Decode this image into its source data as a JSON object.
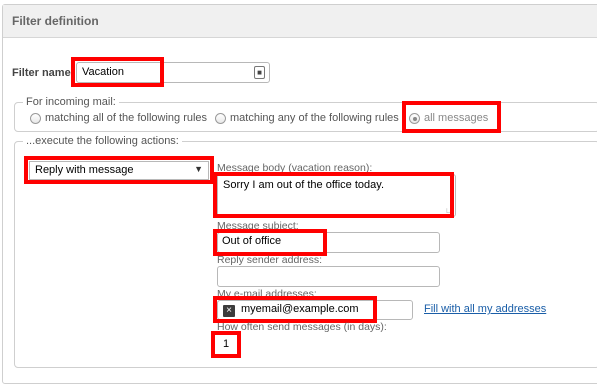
{
  "header": {
    "title": "Filter definition"
  },
  "filter_name": {
    "label": "Filter name:",
    "value": "Vacation"
  },
  "incoming": {
    "legend": "For incoming mail:",
    "options": [
      {
        "label": "matching all of the following rules",
        "checked": false
      },
      {
        "label": "matching any of the following rules",
        "checked": false
      },
      {
        "label": "all messages",
        "checked": true
      }
    ]
  },
  "actions": {
    "legend": "...execute the following actions:",
    "action_select": "Reply with message",
    "body_label": "Message body (vacation reason):",
    "body_value": "Sorry I am out of the office today.",
    "subject_label": "Message subject:",
    "subject_value": "Out of office",
    "sender_label": "Reply sender address:",
    "sender_value": "",
    "addresses_label": "My e-mail addresses:",
    "addresses_chip": "myemail@example.com",
    "fill_link": "Fill with all my addresses",
    "often_label": "How often send messages (in days):",
    "often_value": "1"
  },
  "highlight_color": "#ff0000"
}
